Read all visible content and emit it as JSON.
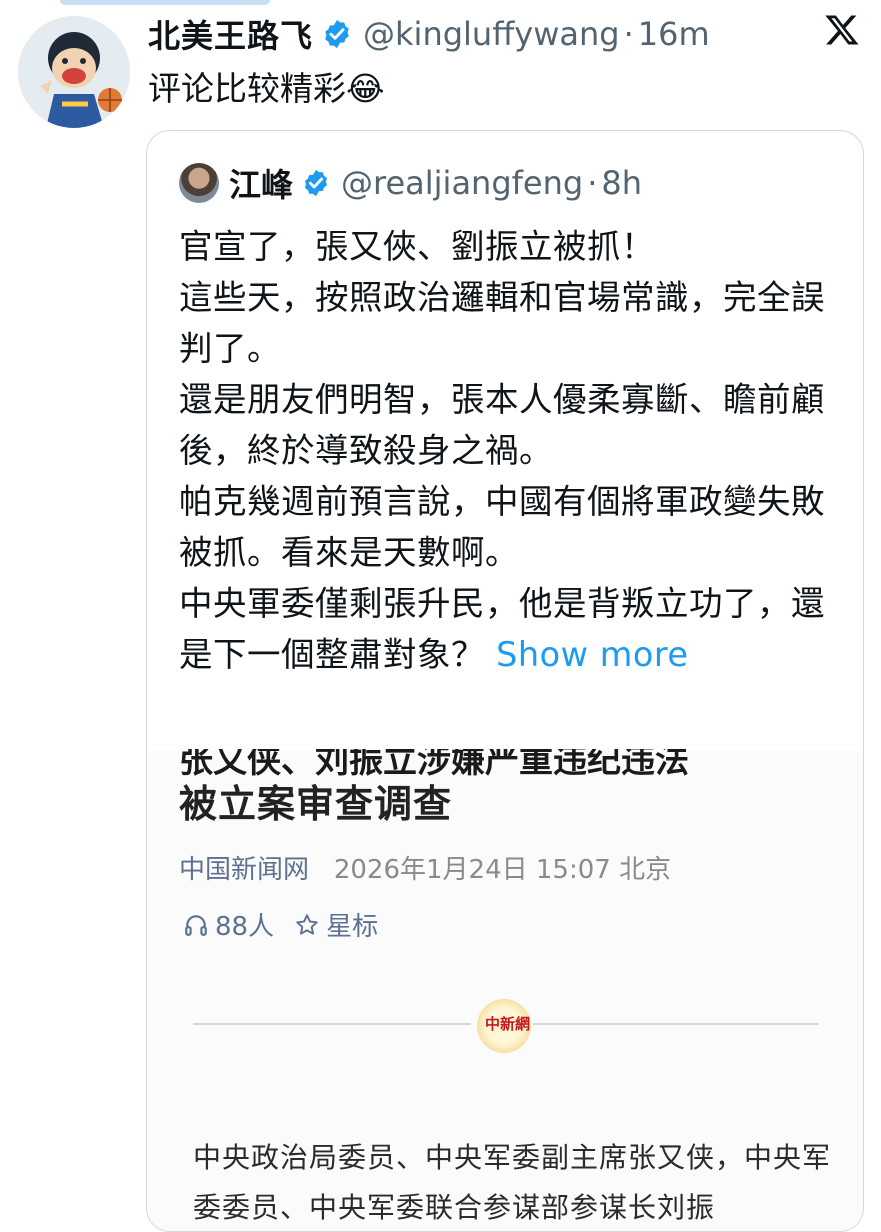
{
  "post": {
    "author_name": "北美王路飞",
    "handle": "@kingluffywang",
    "separator": "·",
    "time": "16m",
    "text": "评论比较精彩😂"
  },
  "quoted": {
    "author_name": "江峰",
    "handle": "@realjiangfeng",
    "separator": "·",
    "time": "8h",
    "lines": [
      "官宣了，張又俠、劉振立被抓！",
      "這些天，按照政治邏輯和官場常識，完全誤判了。",
      "還是朋友們明智，張本人優柔寡斷、瞻前顧後，終於導致殺身之禍。",
      "帕克幾週前預言說，中國有個將軍政變失敗被抓。看來是天數啊。",
      "中央軍委僅剩張升民，他是背叛立功了，還是下一個整肅對象？"
    ],
    "show_more": "Show more"
  },
  "article": {
    "cut_title_line": "张又侠、刘振立涉嫌严重违纪违法",
    "title": "被立案审查调查",
    "source": "中国新闻网",
    "date": "2026年1月24日 15:07 北京",
    "listeners": "88人",
    "star_label": "星标",
    "seal_text": "中新網",
    "paragraph": "中央政治局委员、中央军委副主席张又侠，中央军委委员、中央军委联合参谋部参谋长刘振"
  },
  "colors": {
    "accent": "#1d9bf0",
    "muted": "#536471",
    "source_link": "#5e7190"
  },
  "icons": [
    "verified-badge-icon",
    "x-logo-icon",
    "headphones-icon",
    "star-outline-icon"
  ]
}
